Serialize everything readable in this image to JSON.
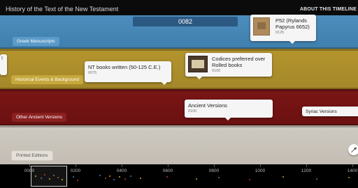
{
  "header": {
    "title": "History of the Text of the New Testament",
    "about_label": "ABOUT THIS TIMELINE"
  },
  "current_year": "0082",
  "bands": {
    "greek": {
      "label": "Greek Manuscripts",
      "color": "#4587b6"
    },
    "historical": {
      "label": "Historical Events & Background",
      "color": "#ad8f2c"
    },
    "other": {
      "label": "Other Ancient Versions",
      "color": "#731313"
    },
    "printed": {
      "label": "Printed Editions",
      "color": "#c9c3ba"
    }
  },
  "events": {
    "p52": {
      "title": "P52 (Rylands Papyrus 6652)",
      "date": "0125",
      "thumb_icon": "papyrus-fragment-image"
    },
    "partial_left": {
      "title": "!"
    },
    "nt_books": {
      "title": "NT books written (50-125 C.E.)",
      "date": "0075"
    },
    "codices": {
      "title": "Codices preferred over Rolled books",
      "date": "0100",
      "thumb_icon": "codex-book-image"
    },
    "ancient_versions": {
      "title": "Ancient Versions",
      "date": "0100"
    },
    "syriac": {
      "title": "Syriac Versions"
    }
  },
  "navigator": {
    "ticks": [
      "0000",
      "0200",
      "0400",
      "0600",
      "0800",
      "1000",
      "1200",
      "1400"
    ],
    "tool_icon": "wrench-icon"
  }
}
